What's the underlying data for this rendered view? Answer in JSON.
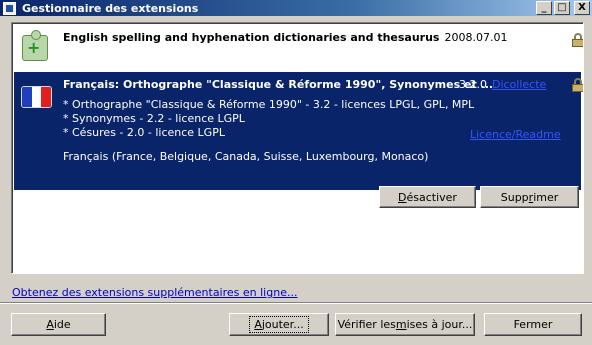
{
  "window": {
    "title": "Gestionnaire des extensions",
    "controls": {
      "minimize": "_",
      "maximize": "□",
      "close": "X"
    }
  },
  "extensions": [
    {
      "name": "English spelling and hyphenation dictionaries and thesaurus",
      "version": "2008.07.01",
      "icon": "puzzle-plus-icon",
      "locked": true
    },
    {
      "name": "Français: Orthographe \"Classique & Réforme 1990\", Synonymes et ...",
      "version": "3.2.0",
      "link1": "Dicollecte",
      "link2": "Licence/Readme",
      "icon": "french-flag-icon",
      "flag_colors": [
        "#1f3fbf",
        "#ffffff",
        "#e02020"
      ],
      "locked": true,
      "details": [
        "* Orthographe \"Classique & Réforme 1990\" - 3.2 - licences LPGL, GPL, MPL",
        "* Synonymes - 2.2 - licence LGPL",
        "* Césures - 2.0 - licence LGPL"
      ],
      "languages": "Français (France, Belgique, Canada, Suisse, Luxembourg, Monaco)",
      "deactivate": {
        "pre": "",
        "key": "D",
        "post": "ésactiver"
      },
      "remove": {
        "pre": "Supp",
        "key": "r",
        "post": "imer"
      },
      "selected": true
    }
  ],
  "online_link": "Obtenez des extensions supplémentaires en ligne...",
  "footer": {
    "help": {
      "pre": "",
      "key": "A",
      "post": "ide"
    },
    "add": {
      "pre": "",
      "key": "A",
      "post": "jouter..."
    },
    "update": {
      "pre": "Vérifier les ",
      "key": "m",
      "post": "ises à jour..."
    },
    "close": "Fermer"
  },
  "colors": {
    "selection": "#0a246a",
    "dialog_bg": "#d4d0c8",
    "link": "#0000cc"
  }
}
